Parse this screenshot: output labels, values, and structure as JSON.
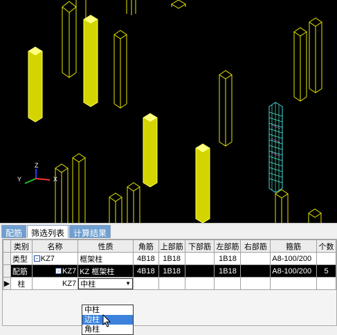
{
  "tabs": [
    {
      "label": "配筋",
      "active": false
    },
    {
      "label": "筛选列表",
      "active": true
    },
    {
      "label": "计算结果",
      "active": false
    }
  ],
  "table": {
    "headers": [
      "类别",
      "名称",
      "性质",
      "角筋",
      "上部筋",
      "下部筋",
      "左部筋",
      "右部筋",
      "箍筋",
      "个数"
    ],
    "rows": [
      {
        "cat": "类型",
        "name": "KZ7",
        "prop": "框架柱",
        "corner": "4B18",
        "top": "1B18",
        "bottom": "",
        "left": "1B18",
        "right": "",
        "stirrup": "A8-100/200",
        "count": ""
      },
      {
        "cat": "配筋",
        "name": "KZ7",
        "prop": "KZ  框架柱",
        "corner": "4B18",
        "top": "1B18",
        "bottom": "",
        "left": "1B18",
        "right": "",
        "stirrup": "A8-100/200",
        "count": "5"
      },
      {
        "cat": "柱",
        "name": "KZ7",
        "prop": "中柱",
        "corner": "",
        "top": "",
        "bottom": "",
        "left": "",
        "right": "",
        "stirrup": "",
        "count": ""
      }
    ]
  },
  "dropdown": {
    "options": [
      "中柱",
      "边柱",
      "角柱"
    ],
    "highlighted": "边柱"
  },
  "axes": {
    "x": "X",
    "y": "Y",
    "z": "Z"
  },
  "colors": {
    "column_fill": "#e8e800",
    "column_wire": "#e8e800",
    "selected_wire": "#40e0e0",
    "tab_active_bg": "#ffffff",
    "tab_bg": "#6f9fd0"
  }
}
